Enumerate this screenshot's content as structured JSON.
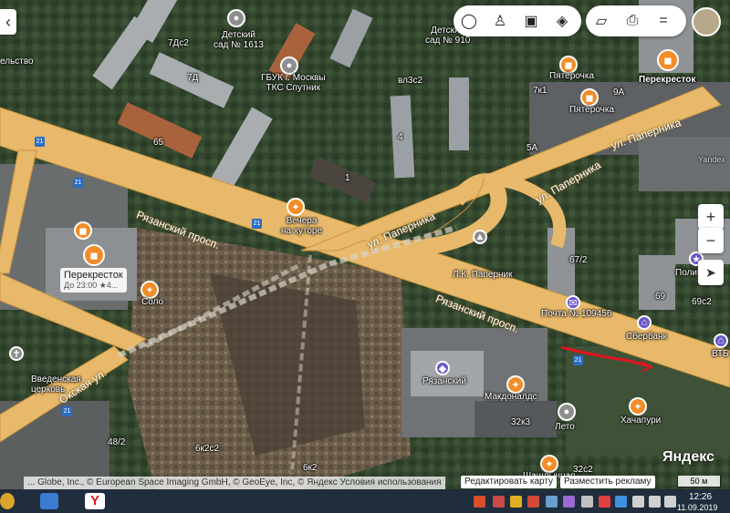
{
  "toolbar": {
    "layers_icon": "layers-icon",
    "panorama_icon": "panorama-icon",
    "transit_icon": "transit-icon",
    "traffic_icon": "traffic-icon",
    "ruler_icon": "ruler-icon",
    "print_icon": "print-icon",
    "menu_label": "="
  },
  "controls": {
    "back_label": "‹",
    "zoom_in": "+",
    "zoom_out": "−",
    "locate_icon": "locate-icon"
  },
  "streets": {
    "ryazansky_1": "Рязанский просп.",
    "ryazansky_2": "Рязанский просп.",
    "papernika_1": "ул. Паперника",
    "papernika_2": "ул. Паперника",
    "papernika_3": "ул. Паперника",
    "okskaya": "Окская ул."
  },
  "labels": {
    "detsky_sad_1613": "Детский\nсад № 1613",
    "gbuk": "ГБУК г. Москвы\nТКС Спутник",
    "detsky_sad_910": "Детский\nсад № 910",
    "pyaterochka_1": "Пятёрочка",
    "pyaterochka_2": "Пятёрочка",
    "perekrestok_top": "Перекресток",
    "vechera": "Вечера\nна хуторе",
    "perekrestok_main": "Перекресток",
    "perekrestok_hours": "До 23:00 ★4...",
    "solo": "Соло",
    "lk_papernik": "Л.К. Паперник",
    "pochta": "Почта № 109456",
    "sberbank": "Сбербанк",
    "policiya": "Полиция",
    "vtb": "ВТБ",
    "ryazansky_mall": "Рязанский",
    "mcdonalds": "Макдоналдс",
    "leto": "Лето",
    "khachapuri": "Хачапури",
    "vvedenskaya": "Введенская\nцерковь",
    "shashlychnaya": "Шашлычная",
    "yandex_top": "Yandex"
  },
  "buildings": {
    "b7dc2": "7Дс2",
    "b7d": "7Д",
    "b6s": "6s",
    "b1": "1",
    "vl3c2": "вл3с2",
    "b7k1": "7к1",
    "b9a": "9А",
    "b5a": "5А",
    "b4": "4",
    "b67_2": "67/2",
    "b69": "69",
    "b69c2": "69с2",
    "b32k3": "32к3",
    "b48_2": "48/2",
    "b6k2c2": "6к2с2",
    "b6k2": "6к2",
    "b32c2": "32с2",
    "b65": "65",
    "tserkov_left": "ельство"
  },
  "bus_stop_label": "21",
  "attribution": {
    "copyright": "... Globe, Inc., © European Space Imaging GmbH, © GeoEye, Inc, © Яндекс Условия использования",
    "edit_map": "Редактировать карту",
    "advertise": "Разместить рекламу",
    "scale": "50 м",
    "logo": "Яндекс"
  },
  "taskbar": {
    "time": "12:26",
    "date": "11.09.2019",
    "app_yandex": "Y"
  },
  "colors": {
    "road": "#e8b96a",
    "road_edge": "#c9953d",
    "poi_orange": "#f28c28",
    "poi_purple": "#6a57c8",
    "route_red": "#e0141e",
    "taskbar": "#1f2d3d"
  }
}
